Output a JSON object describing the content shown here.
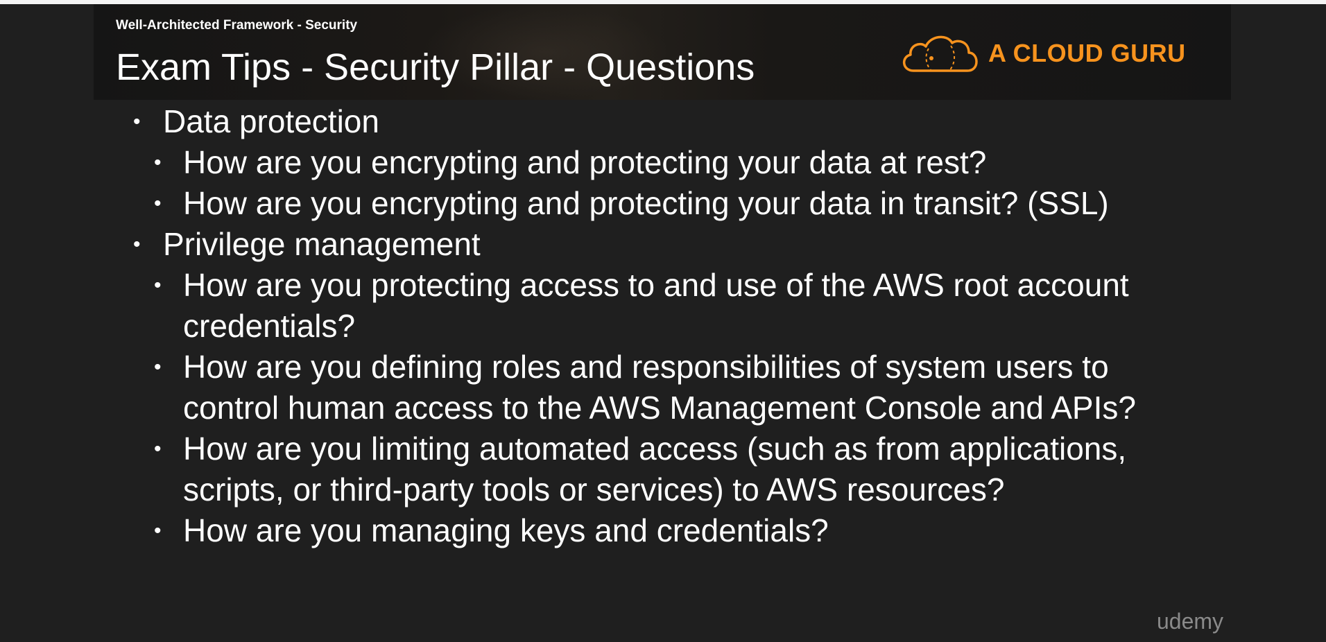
{
  "slide": {
    "subtitle": "Well-Architected Framework - Security",
    "title": "Exam Tips - Security Pillar - Questions",
    "brand": {
      "name": "A CLOUD GURU",
      "color": "#f7931e",
      "icon": "cloud-logo-icon"
    },
    "bullets": [
      {
        "text": "Data protection",
        "children": [
          "How are you encrypting and protecting your data at rest?",
          "How are you encrypting and protecting your data in transit? (SSL)"
        ]
      },
      {
        "text": "Privilege management",
        "children": [
          "How are you protecting access to and use of the AWS root account credentials?",
          "How are you defining roles and responsibilities of system users to control human access to the AWS Management Console and APIs?",
          "How are you limiting automated access (such as from applications, scripts, or third-party tools or services) to AWS resources?",
          "How are you managing keys and credentials?"
        ]
      }
    ]
  },
  "watermark": "udemy",
  "bullet_glyph": "•"
}
